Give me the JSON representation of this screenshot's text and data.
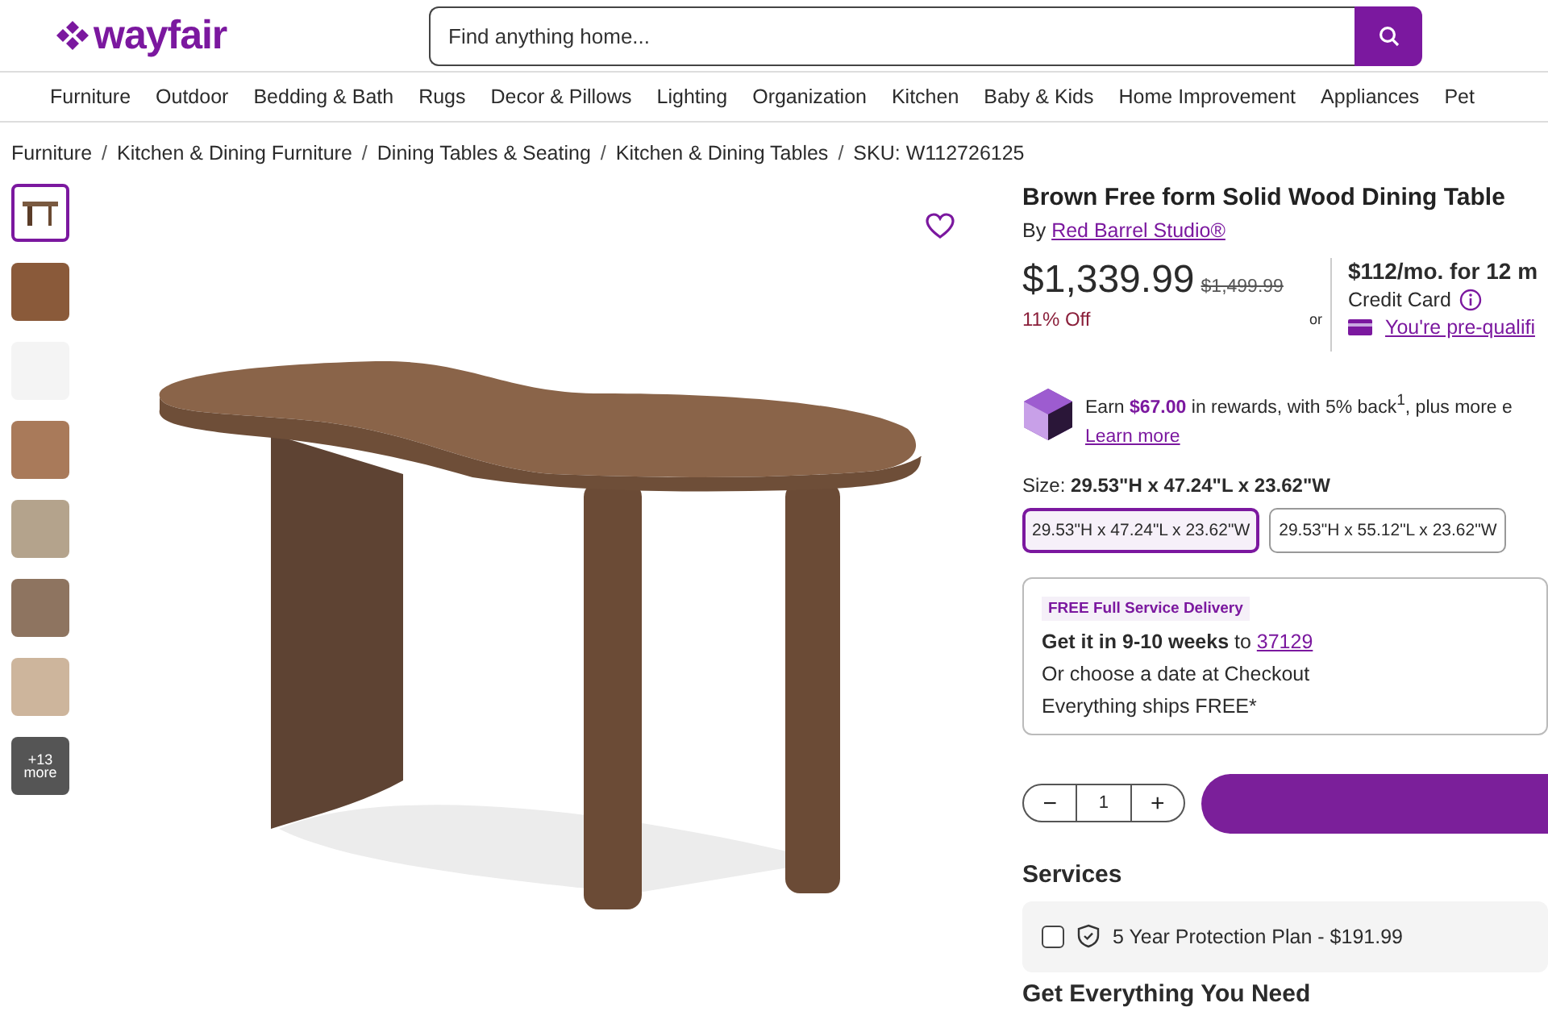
{
  "header": {
    "logo": "wayfair",
    "search": {
      "placeholder": "Find anything home..."
    }
  },
  "nav": [
    "Furniture",
    "Outdoor",
    "Bedding & Bath",
    "Rugs",
    "Decor & Pillows",
    "Lighting",
    "Organization",
    "Kitchen",
    "Baby & Kids",
    "Home Improvement",
    "Appliances",
    "Pet"
  ],
  "breadcrumb": [
    "Furniture",
    "Kitchen & Dining Furniture",
    "Dining Tables & Seating",
    "Kitchen & Dining Tables"
  ],
  "breadcrumb_separator": "/",
  "sku": "SKU: W112726125",
  "gallery": {
    "thumbnails": [
      {
        "selected": true
      },
      {
        "selected": false
      },
      {
        "selected": false
      },
      {
        "selected": false
      },
      {
        "selected": false
      },
      {
        "selected": false
      },
      {
        "selected": false
      }
    ],
    "more": "+13 more"
  },
  "product": {
    "title": "Brown Free form Solid Wood Dining Table",
    "by": "By",
    "brand": "Red Barrel Studio®",
    "price": "$1,339.99",
    "was": "$1,499.99",
    "discount": "11% Off",
    "or": "or",
    "financing": {
      "monthly": "$112/mo. for 12 m",
      "card": "Credit Card",
      "prequal": "You're pre-qualifi"
    }
  },
  "rewards": {
    "text": "Earn **$67.00** in rewards, with 5% back$^{1}$, plus more e",
    "link": "Learn more"
  },
  "size": {
    "label": "Size:",
    "value": "29.53\"H x 47.24\"L x 23.62\"W",
    "options": [
      {
        "label": "29.53\"H x 47.24\"L x 23.62\"W",
        "selected": true
      },
      {
        "label": "29.53\"H x 55.12\"L x 23.62\"W",
        "selected": false
      }
    ]
  },
  "delivery": {
    "badge": "FREE Full Service Delivery",
    "eta": "**Get it in 9-10 weeks** to",
    "zip": "37129",
    "lines": [
      "Or choose a date at Checkout",
      "Everything ships FREE*"
    ]
  },
  "quantity": {
    "minus": "−",
    "value": "1",
    "plus": "+"
  },
  "services": {
    "title": "Services",
    "items": [
      {
        "label": "5 Year Protection Plan - $191.99",
        "checked": false
      }
    ]
  },
  "next_section": "Get Everything You Need"
}
